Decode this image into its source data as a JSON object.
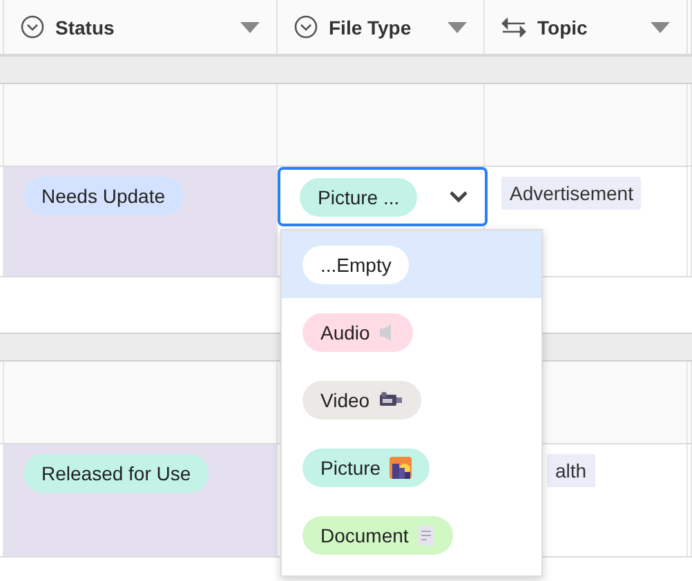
{
  "columns": [
    {
      "label": "Status",
      "kind": "single-select"
    },
    {
      "label": "File Type",
      "kind": "single-select"
    },
    {
      "label": "Topic",
      "kind": "linked"
    }
  ],
  "groups": [
    {
      "rows": [
        {
          "status": {
            "label": "Needs Update",
            "color": "#d4e2ff"
          },
          "file_type": {
            "label": "Picture ...",
            "color": "#c2f3e6",
            "editing": true
          },
          "topic": {
            "label": "Advertisement"
          }
        }
      ]
    },
    {
      "rows": [
        {
          "status": {
            "label": "Released for Use",
            "color": "#c2f3e6"
          },
          "topic": {
            "label": "alth"
          }
        }
      ]
    }
  ],
  "dropdown": {
    "options": [
      {
        "label": "...Empty",
        "color": "#ffffff",
        "kind": "empty",
        "selected": true
      },
      {
        "label": "Audio",
        "color": "#ffdce5",
        "kind": "audio",
        "selected": false
      },
      {
        "label": "Video",
        "color": "#ebe9e6",
        "kind": "video",
        "selected": false
      },
      {
        "label": "Picture",
        "color": "#c2f3e6",
        "kind": "picture",
        "selected": false
      },
      {
        "label": "Document",
        "color": "#d1f7c4",
        "kind": "document",
        "selected": false
      }
    ]
  }
}
